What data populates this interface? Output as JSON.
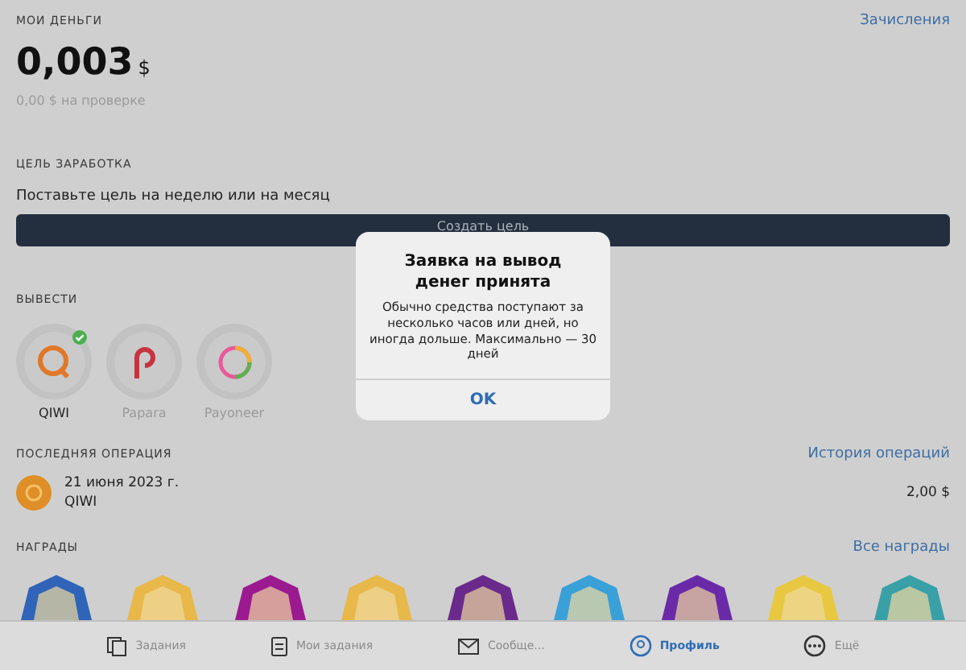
{
  "balance": {
    "heading": "МОИ ДЕНЬГИ",
    "link": "Зачисления",
    "amount": "0,003",
    "currency": "$",
    "pending": "0,00 $ на проверке"
  },
  "goal": {
    "heading": "ЦЕЛЬ ЗАРАБОТКА",
    "text": "Поставьте цель на неделю или на месяц",
    "button": "Создать цель"
  },
  "withdraw": {
    "heading": "ВЫВЕСТИ",
    "methods": [
      {
        "kind": "qiwi",
        "label": "QIWI",
        "selected": true
      },
      {
        "kind": "papara",
        "label": "Papara",
        "selected": false
      },
      {
        "kind": "payoneer",
        "label": "Payoneer",
        "selected": false
      }
    ]
  },
  "last_operation": {
    "heading": "ПОСЛЕДНЯЯ ОПЕРАЦИЯ",
    "link": "История операций",
    "date": "21 июня 2023 г.",
    "method": "QIWI",
    "amount": "2,00 $"
  },
  "awards": {
    "heading": "НАГРАДЫ",
    "link": "Все награды",
    "items": [
      {
        "color": "#2f64b8"
      },
      {
        "color": "#e8b84a"
      },
      {
        "color": "#9b1a8f"
      },
      {
        "color": "#e8b84a"
      },
      {
        "color": "#6a2a8c"
      },
      {
        "color": "#3aa0d8"
      },
      {
        "color": "#6a2aa8"
      },
      {
        "color": "#e8c840"
      },
      {
        "color": "#3aa0a8"
      }
    ]
  },
  "dialog": {
    "title": "Заявка на вывод денег принята",
    "message": "Обычно средства поступают за несколько часов или дней, но иногда дольше. Максимально — 30 дней",
    "button": "OK"
  },
  "tab_bar": [
    {
      "kind": "tasks",
      "label": "Задания",
      "selected": false
    },
    {
      "kind": "my_tasks",
      "label": "Мои задания",
      "selected": false
    },
    {
      "kind": "messages",
      "label": "Сообще...",
      "selected": false
    },
    {
      "kind": "profile",
      "label": "Профиль",
      "selected": true
    },
    {
      "kind": "more",
      "label": "Ещё",
      "selected": false
    }
  ]
}
